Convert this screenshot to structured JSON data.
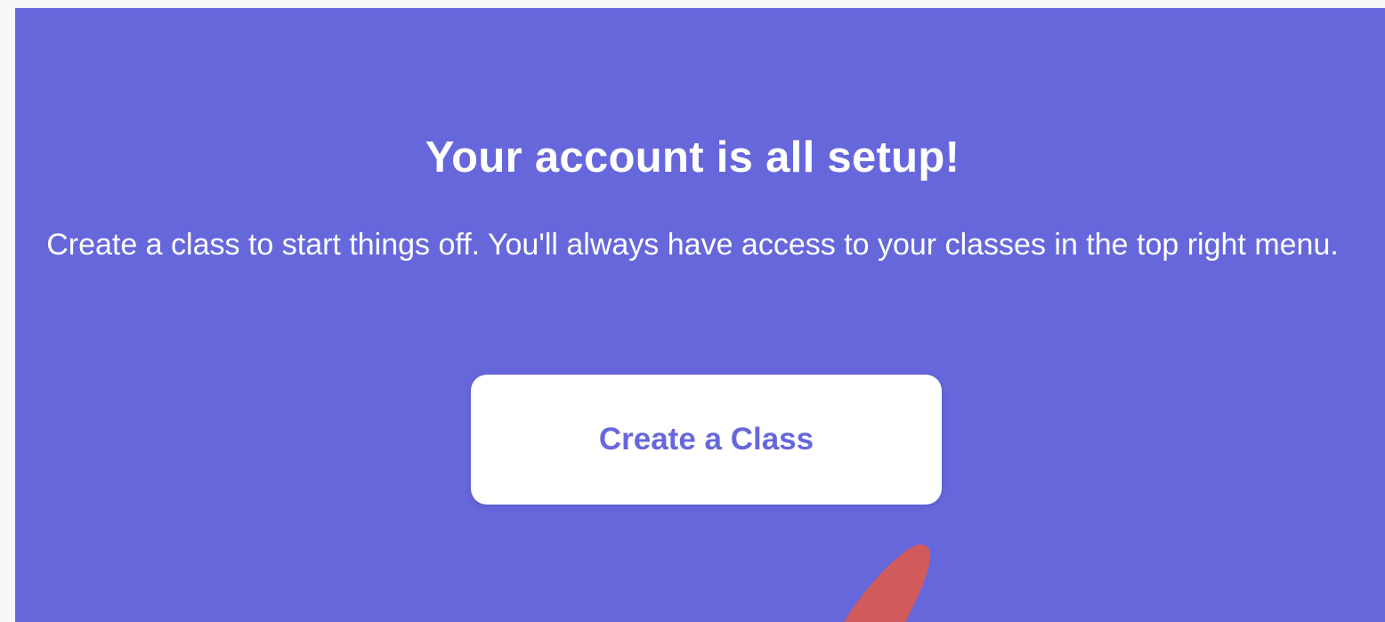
{
  "colors": {
    "panel_background": "#6767dc",
    "page_background": "#f7f7f8",
    "button_background": "#ffffff",
    "button_text": "#6767dc",
    "annotation_stroke": "#d15b5b"
  },
  "onboarding": {
    "title": "Your account is all setup!",
    "description": "Create a class to start things off. You'll always have access to your classes in the top right menu.",
    "create_button_label": "Create a Class"
  }
}
